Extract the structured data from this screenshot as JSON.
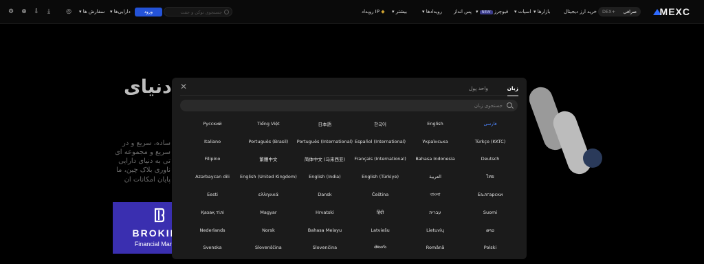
{
  "header": {
    "logo_text": "MEXC",
    "exchange_toggle": {
      "options": [
        "صرافی",
        "DEX+"
      ]
    },
    "nav": {
      "buy_crypto": "خرید ارز دیجیتال",
      "markets": "بازارها",
      "spot": "اسپات",
      "futures": "فیوچرز",
      "futures_badge": "NEW",
      "savings": "پس انداز",
      "events": "رویدادها",
      "more": "بیشتر",
      "ip_event": "رویداد IP"
    },
    "search_placeholder": "جستجوی توکن و جفت",
    "login_button": "ورود",
    "assets": "دارایی‌ها",
    "orders": "سفارش ها"
  },
  "hero": {
    "title": "دنیای",
    "lines": [
      "ساده، سریع و در",
      "سریع و مجموعه ای",
      "تی به دنیای دارایی",
      "ناوری بلاک چین، ما",
      "پایان امکانات آن"
    ]
  },
  "watermark": {
    "name": "BROKIFY",
    "subtitle": "Financial Markets"
  },
  "modal": {
    "close_icon": "close-icon",
    "tabs": {
      "language": "زبان",
      "currency": "واحد پول"
    },
    "search_placeholder": "جستجوی زبان",
    "active_language": "فارسی",
    "languages": [
      "فارسی",
      "English",
      "한국어",
      "日本語",
      "Tiếng Việt",
      "Русский",
      "Türkçe (KKTC)",
      "Українська",
      "Español (International)",
      "Português (International)",
      "Português (Brasil)",
      "Italiano",
      "Deutsch",
      "Bahasa Indonesia",
      "Français (International)",
      "简体中文 (马来西亚)",
      "繁體中文",
      "Filipino",
      "ไทย",
      "العربية",
      "English (Türkiye)",
      "English (India)",
      "English (United Kingdom)",
      "Azərbaycan dili",
      "Български",
      "বাংলা",
      "Čeština",
      "Dansk",
      "ελληνικά",
      "Eesti",
      "Suomi",
      "עברית",
      "हिंदी",
      "Hrvatski",
      "Magyar",
      "Қазақ тілі",
      "ລາວ",
      "Lietuvių",
      "Latviešu",
      "Bahasa Melayu",
      "Norsk",
      "Nederlands",
      "Polski",
      "Română",
      "తెలుగు",
      "Slovenčina",
      "Slovenščina",
      "Svenska"
    ]
  },
  "colors": {
    "accent": "#2453d8",
    "active_language": "#4e86ff",
    "watermark_bg": "#3a2fb0"
  }
}
